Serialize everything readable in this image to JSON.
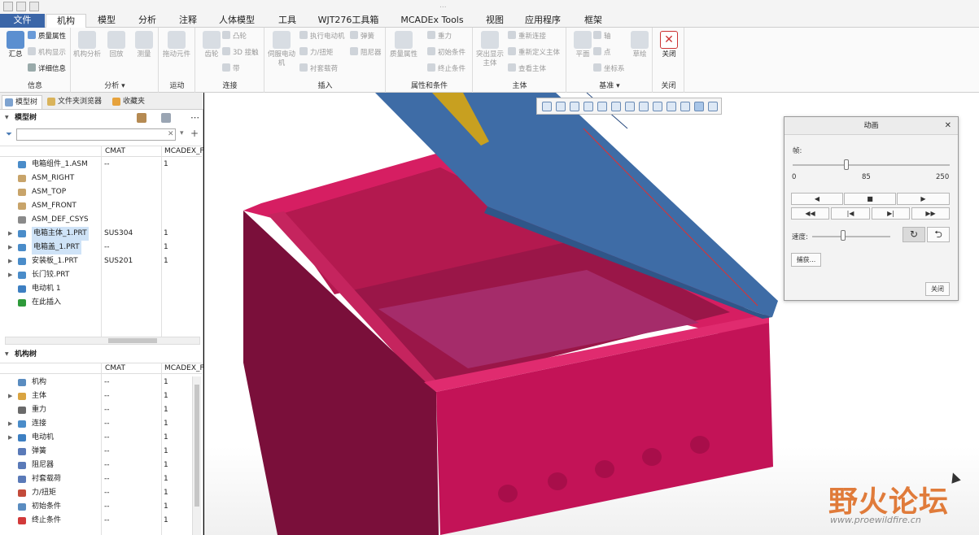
{
  "title": {
    "partial": "..."
  },
  "menu_tabs": [
    {
      "label": "文件"
    },
    {
      "label": "机构"
    },
    {
      "label": "模型"
    },
    {
      "label": "分析"
    },
    {
      "label": "注释"
    },
    {
      "label": "人体模型"
    },
    {
      "label": "工具"
    },
    {
      "label": "WJT276工具箱"
    },
    {
      "label": "MCADEx Tools"
    },
    {
      "label": "视图"
    },
    {
      "label": "应用程序"
    },
    {
      "label": "框架"
    }
  ],
  "ribbon": {
    "info": {
      "label": "信息",
      "summary": "汇总",
      "mass": "质量属性",
      "mech_display": "机构显示",
      "detail": "详细信息"
    },
    "analysis": {
      "label": "分析 ▾",
      "mech_analysis": "机构分析",
      "playback": "回放",
      "measure": "测量"
    },
    "motion": {
      "label": "运动",
      "drag": "拖动元件"
    },
    "connection": {
      "label": "连接",
      "gear": "齿轮",
      "cam": "凸轮",
      "contact3d": "3D 接触",
      "belt": "带"
    },
    "insert": {
      "label": "插入",
      "servo": "伺服电动机",
      "exec_motor": "执行电动机",
      "spring": "弹簧",
      "force": "力/扭矩",
      "damper": "阻尼器",
      "bushing": "衬套载荷"
    },
    "props": {
      "label": "属性和条件",
      "mass_props": "质量属性",
      "init_cond": "初始条件",
      "term_cond": "终止条件",
      "gravity": "重力"
    },
    "body": {
      "label": "主体",
      "highlight": "突出显示主体",
      "reconnect": "重新连接",
      "redefine": "重新定义主体",
      "view_body": "查看主体"
    },
    "datum": {
      "label": "基准 ▾",
      "plane": "平面",
      "axis": "轴",
      "point": "点",
      "csys": "坐标系",
      "sketch": "草绘"
    },
    "close": {
      "label": "关闭",
      "close": "关闭"
    }
  },
  "panel_tabs": [
    {
      "label": "模型树"
    },
    {
      "label": "文件夹浏览器"
    },
    {
      "label": "收藏夹"
    }
  ],
  "model_tree": {
    "title": "模型树",
    "cols": [
      "CMAT",
      "MCADEX_F"
    ],
    "rows": [
      {
        "name": "电箱组件_1.ASM",
        "c1": "--",
        "c2": "1",
        "exp": "",
        "color": "#4a8cc9"
      },
      {
        "name": "ASM_RIGHT",
        "c1": "",
        "c2": "",
        "exp": "",
        "color": "#c8a46a"
      },
      {
        "name": "ASM_TOP",
        "c1": "",
        "c2": "",
        "exp": "",
        "color": "#c8a46a"
      },
      {
        "name": "ASM_FRONT",
        "c1": "",
        "c2": "",
        "exp": "",
        "color": "#c8a46a"
      },
      {
        "name": "ASM_DEF_CSYS",
        "c1": "",
        "c2": "",
        "exp": "",
        "color": "#8a8a8a"
      },
      {
        "name": "电箱主体_1.PRT",
        "c1": "SUS304",
        "c2": "1",
        "exp": "▶",
        "color": "#4a8cc9",
        "sel": true
      },
      {
        "name": "电箱盖_1.PRT",
        "c1": "--",
        "c2": "1",
        "exp": "▶",
        "color": "#4a8cc9",
        "sel": true
      },
      {
        "name": "安装板_1.PRT",
        "c1": "SUS201",
        "c2": "1",
        "exp": "▶",
        "color": "#4a8cc9"
      },
      {
        "name": "长门铰.PRT",
        "c1": "",
        "c2": "",
        "exp": "▶",
        "color": "#4a8cc9"
      },
      {
        "name": "电动机 1",
        "c1": "",
        "c2": "",
        "exp": "",
        "color": "#3d7fc2"
      },
      {
        "name": "在此插入",
        "c1": "",
        "c2": "",
        "exp": "",
        "color": "#2e9a3a"
      }
    ]
  },
  "mech_tree": {
    "title": "机构树",
    "cols": [
      "CMAT",
      "MCADEX_F"
    ],
    "rows": [
      {
        "name": "机构",
        "c1": "--",
        "c2": "1",
        "exp": "",
        "color": "#5a8cc0"
      },
      {
        "name": "主体",
        "c1": "--",
        "c2": "1",
        "exp": "▶",
        "color": "#d9a441"
      },
      {
        "name": "重力",
        "c1": "--",
        "c2": "1",
        "exp": "",
        "color": "#6a6a6a"
      },
      {
        "name": "连接",
        "c1": "--",
        "c2": "1",
        "exp": "▶",
        "color": "#4a8cc9"
      },
      {
        "name": "电动机",
        "c1": "--",
        "c2": "1",
        "exp": "▶",
        "color": "#3d7fc2"
      },
      {
        "name": "弹簧",
        "c1": "--",
        "c2": "1",
        "exp": "",
        "color": "#5a7ab8"
      },
      {
        "name": "阻尼器",
        "c1": "--",
        "c2": "1",
        "exp": "",
        "color": "#5a7ab8"
      },
      {
        "name": "衬套载荷",
        "c1": "--",
        "c2": "1",
        "exp": "",
        "color": "#5a7ab8"
      },
      {
        "name": "力/扭矩",
        "c1": "--",
        "c2": "1",
        "exp": "",
        "color": "#c34a3a"
      },
      {
        "name": "初始条件",
        "c1": "--",
        "c2": "1",
        "exp": "",
        "color": "#5a8cc0"
      },
      {
        "name": "终止条件",
        "c1": "--",
        "c2": "1",
        "exp": "",
        "color": "#d23a3a"
      }
    ]
  },
  "anim_dialog": {
    "title": "动画",
    "frame_label": "帧:",
    "frame_min": "0",
    "frame_value": "85",
    "frame_max": "250",
    "frame_fraction": 0.34,
    "speed_label": "速度:",
    "speed_fraction": 0.4,
    "capture": "捕获...",
    "close": "关闭",
    "btns_row1": [
      "◀",
      "■",
      "▶"
    ],
    "btns_row2": [
      "◀◀",
      "|◀",
      "▶|",
      "▶▶"
    ],
    "loop_icon": "↻",
    "reverse_icon": "⮌"
  },
  "watermark": {
    "brand": "野火论坛",
    "url": "www.proewildfire.cn"
  },
  "colors": {
    "box": "#c8165a",
    "lid": "#3e6ca6",
    "file_tab": "#3b66a8"
  }
}
